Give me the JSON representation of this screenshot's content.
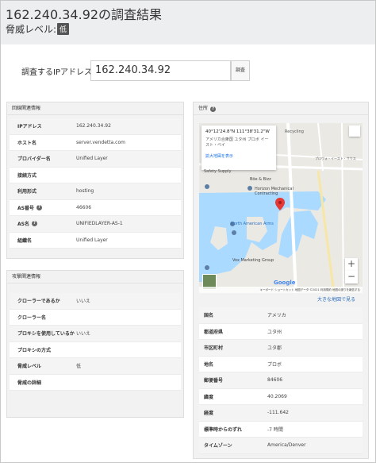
{
  "header": {
    "title": "162.240.34.92の調査結果",
    "threat_label": "脅威レベル:",
    "threat_badge": "低"
  },
  "search": {
    "label": "調査するIPアドレス",
    "value": "162.240.34.92",
    "button_label": "調査"
  },
  "network_panel": {
    "title": "回線関連情報",
    "rows": [
      {
        "key": "IPアドレス",
        "value": "162.240.34.92",
        "help": false
      },
      {
        "key": "ホスト名",
        "value": "server.vendetta.com",
        "help": false
      },
      {
        "key": "プロバイダー名",
        "value": "Unified Layer",
        "help": false
      },
      {
        "key": "接続方式",
        "value": "",
        "help": false
      },
      {
        "key": "利用形式",
        "value": "hosting",
        "help": false
      },
      {
        "key": "AS番号",
        "value": "46606",
        "help": true
      },
      {
        "key": "AS名",
        "value": "UNIFIEDLAYER-AS-1",
        "help": true
      },
      {
        "key": "組織名",
        "value": "Unified Layer",
        "help": false
      }
    ]
  },
  "attack_panel": {
    "title": "攻撃関連情報",
    "rows": [
      {
        "key": "クローラーであるか",
        "value": "いいえ"
      },
      {
        "key": "クローラー名",
        "value": ""
      },
      {
        "key": "プロキシを使用しているか",
        "value": "いいえ"
      },
      {
        "key": "プロキシの方式",
        "value": ""
      },
      {
        "key": "脅威レベル",
        "value": "低"
      },
      {
        "key": "脅威の詳細",
        "value": ""
      }
    ]
  },
  "location_panel": {
    "title": "住所",
    "map": {
      "info_coord": "40°12'24.8\"N 111°38'31.2\"W",
      "info_addr": "アメリカ合衆国 ユタ州 プロボ イースト・ベイ",
      "info_link": "拡大地図を表示",
      "labels": {
        "recycling": "Recycling",
        "safety": "Safety Supply",
        "boe": "Böe & Bizz",
        "horizon": "Horizon Mechanical Contracting",
        "north_american": "North American Arms",
        "vox": "Vox Marketing Group",
        "road": "プロヴォ・イースト・サウス"
      },
      "google": "Google",
      "footer": "キーボード ショートカット  地図データ ©2021  利用規約  地図の誤りを報告する",
      "zoom_in": "+",
      "zoom_out": "−"
    },
    "big_map_link": "大きな地図で見る",
    "rows": [
      {
        "key": "国名",
        "value": "アメリカ"
      },
      {
        "key": "都道府県",
        "value": "ユタ州"
      },
      {
        "key": "市区町村",
        "value": "ユタ郡"
      },
      {
        "key": "地名",
        "value": "プロボ"
      },
      {
        "key": "郵便番号",
        "value": "84606"
      },
      {
        "key": "緯度",
        "value": "40.2069"
      },
      {
        "key": "経度",
        "value": "-111.642"
      },
      {
        "key": "標準時からのずれ",
        "value": "-7 時間"
      },
      {
        "key": "タイムゾーン",
        "value": "America/Denver"
      }
    ]
  },
  "colors": {
    "header_bg": "#eceef0",
    "panel_bg": "#f2f2f2",
    "badge_bg": "#555555",
    "link": "#2a6ebb",
    "map_water": "#aadaff",
    "map_pin": "#e53935"
  }
}
